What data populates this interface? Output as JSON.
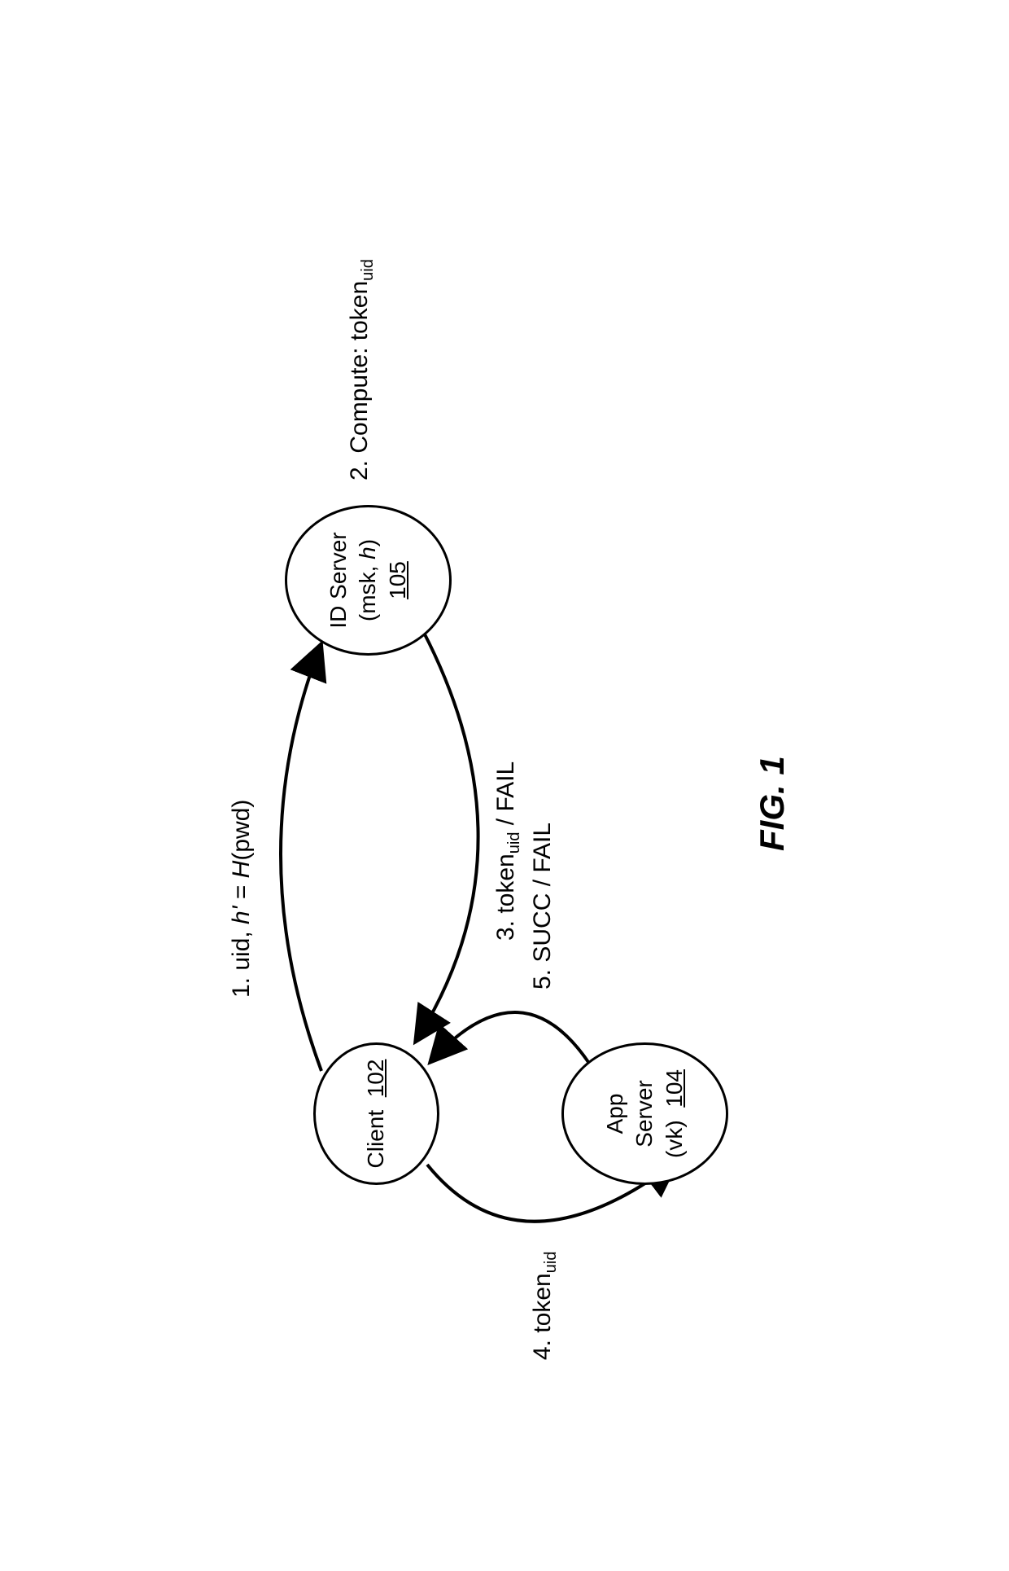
{
  "nodes": {
    "client": {
      "label": "Client",
      "ref": "102"
    },
    "idserver": {
      "line1": "ID Server",
      "line2": "(msk, h)",
      "ref": "105"
    },
    "appserver": {
      "line1": "App",
      "line2": "Server",
      "line3": "(vk)",
      "ref": "104"
    }
  },
  "edges": {
    "e1_prefix": "1. uid, ",
    "e1_hprime": "h'",
    "e1_eq": " = ",
    "e1_H": "H",
    "e1_pwd": "(pwd)",
    "e2_prefix": "2. Compute: token",
    "e2_sub": "uid",
    "e3_prefix": "3. token",
    "e3_sub": "uid",
    "e3_suffix": " / FAIL",
    "e4_prefix": "4. token",
    "e4_sub": "uid",
    "e5": "5. SUCC / FAIL"
  },
  "figure_caption": "FIG. 1"
}
